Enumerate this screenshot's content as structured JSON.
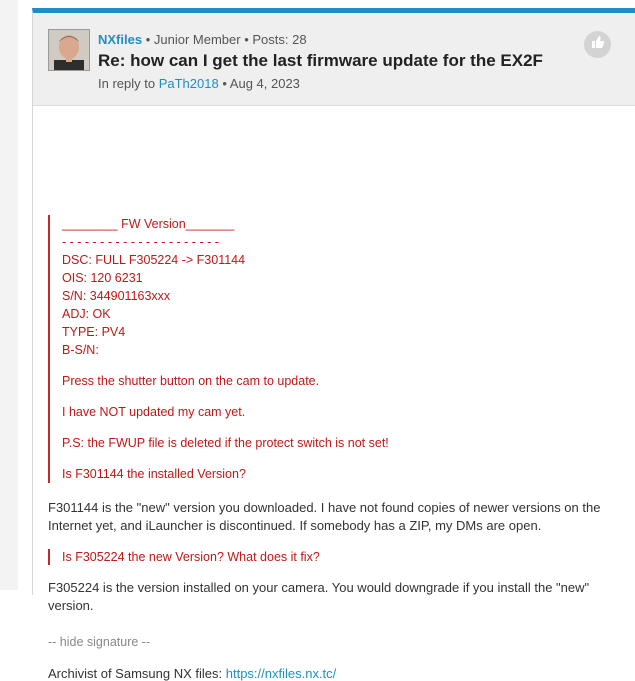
{
  "post": {
    "author": "NXfiles",
    "role": "Junior Member",
    "posts_label": "Posts: 28",
    "title": "Re: how can I get the last firmware update for the EX2F",
    "reply_prefix": "In reply to",
    "reply_user": "PaTh2018",
    "date": "Aug 4, 2023",
    "like_icon": "thumbs-up-icon"
  },
  "quote": {
    "lines": [
      "________ FW Version_______",
      "- - - - - - - - - - - - - - - - - - - - -",
      "DSC: FULL F305224 -> F301144",
      "OIS: 120 6231",
      "S/N: 344901163xxx",
      "ADJ: OK",
      "TYPE: PV4",
      "B-S/N:"
    ],
    "para1": "Press the shutter button on the cam to update.",
    "para2": "I have NOT updated my cam yet.",
    "para3": "P.S: the FWUP file is deleted if the protect switch is not set!",
    "para4": "Is F301144 the installed Version?"
  },
  "answer1": "F301144 is the \"new\" version you downloaded. I have not found copies of newer versions on the Internet yet, and iLauncher is discontinued. If somebody has a ZIP, my DMs are open.",
  "quote2": "Is F305224 the new Version? What does it fix?",
  "answer2": "F305224 is the version installed on your camera. You would downgrade if you install the \"new\" version.",
  "signature": {
    "toggle": "-- hide signature --",
    "text": "Archivist of Samsung NX files: ",
    "link": "https://nxfiles.nx.tc/"
  },
  "colors": {
    "accent": "#1f8fc1",
    "quote_red": "#c01818"
  }
}
